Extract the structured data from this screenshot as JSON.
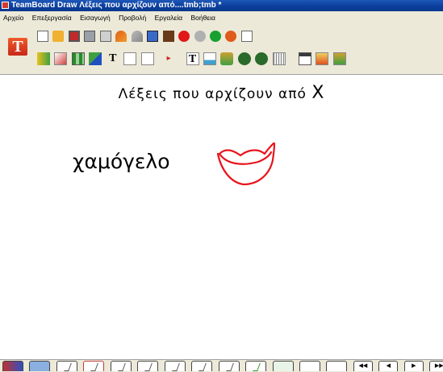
{
  "window": {
    "title": "TeamBoard Draw Λέξεις που αρχίζουν από....tmb;tmb *"
  },
  "menubar": {
    "items": [
      "Αρχείο",
      "Επεξεργασία",
      "Εισαγωγή",
      "Προβολή",
      "Εργαλεία",
      "Βοήθεια"
    ]
  },
  "toolbar": {
    "logo_letter": "T",
    "text_tool_glyph": "T",
    "text_tool2_glyph": "T"
  },
  "canvas": {
    "heading_text": "Λέξεις που αρχίζουν από ",
    "heading_letter": "Χ",
    "word": "χαμόγελο",
    "drawing": "smile-sketch"
  },
  "bottom_bar": {
    "nav_first": "◀◀",
    "nav_prev": "◀",
    "nav_next": "▶",
    "nav_last": "▶▶"
  },
  "colors": {
    "titlebar": "#0a3d9a",
    "chrome": "#ece9d8",
    "sketch": "#e8141c"
  }
}
